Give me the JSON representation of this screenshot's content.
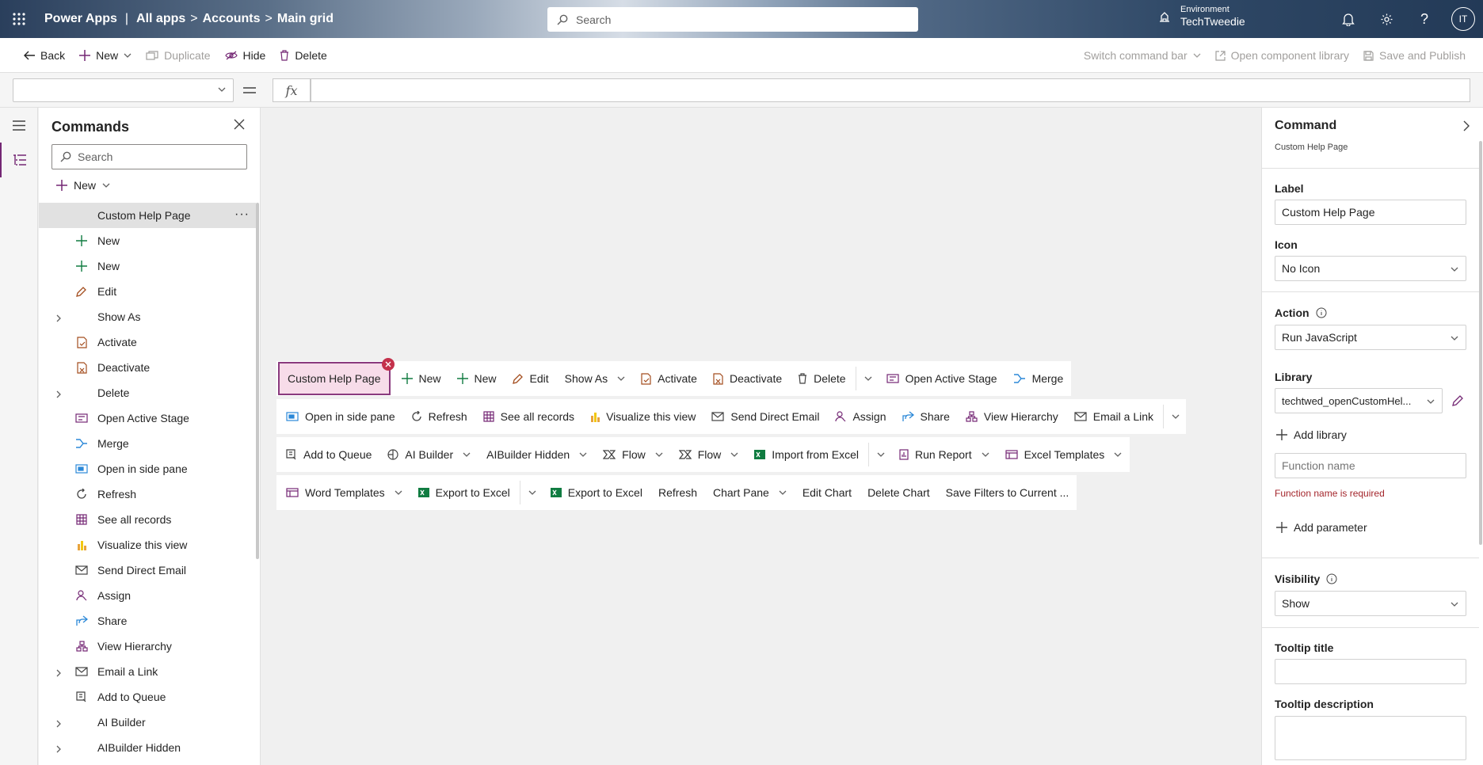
{
  "header": {
    "app_name": "Power Apps",
    "sep1": "|",
    "crumb_app": "All apps",
    "sep2": ">",
    "crumb_table": "Accounts",
    "sep3": ">",
    "crumb_view": "Main grid",
    "search_placeholder": "Search",
    "env_caption": "Environment",
    "env_name": "TechTweedie",
    "avatar_initials": "IT"
  },
  "command_bar": {
    "back": "Back",
    "new": "New",
    "duplicate": "Duplicate",
    "hide": "Hide",
    "delete": "Delete",
    "switch": "Switch command bar",
    "open_lib": "Open component library",
    "save_publish": "Save and Publish"
  },
  "formula": {
    "fx": "fx"
  },
  "left_panel": {
    "title": "Commands",
    "search_placeholder": "Search",
    "new_label": "New",
    "items": [
      {
        "label": "Custom Help Page",
        "icon": "none",
        "expand": false,
        "selected": true
      },
      {
        "label": "New",
        "icon": "plus-icon",
        "expand": false
      },
      {
        "label": "New",
        "icon": "plus-icon",
        "expand": false
      },
      {
        "label": "Edit",
        "icon": "pencil-icon",
        "expand": false
      },
      {
        "label": "Show As",
        "icon": "none",
        "expand": true
      },
      {
        "label": "Activate",
        "icon": "activate-icon",
        "expand": false
      },
      {
        "label": "Deactivate",
        "icon": "deactivate-icon",
        "expand": false
      },
      {
        "label": "Delete",
        "icon": "none",
        "expand": true
      },
      {
        "label": "Open Active Stage",
        "icon": "stage-icon",
        "expand": false
      },
      {
        "label": "Merge",
        "icon": "merge-icon",
        "expand": false
      },
      {
        "label": "Open in side pane",
        "icon": "sidepane-icon",
        "expand": false
      },
      {
        "label": "Refresh",
        "icon": "refresh-icon",
        "expand": false
      },
      {
        "label": "See all records",
        "icon": "grid-icon",
        "expand": false
      },
      {
        "label": "Visualize this view",
        "icon": "chart-icon",
        "expand": false
      },
      {
        "label": "Send Direct Email",
        "icon": "email-icon",
        "expand": false
      },
      {
        "label": "Assign",
        "icon": "person-icon",
        "expand": false
      },
      {
        "label": "Share",
        "icon": "share-icon",
        "expand": false
      },
      {
        "label": "View Hierarchy",
        "icon": "hierarchy-icon",
        "expand": false
      },
      {
        "label": "Email a Link",
        "icon": "email-icon",
        "expand": true
      },
      {
        "label": "Add to Queue",
        "icon": "queue-icon",
        "expand": false
      },
      {
        "label": "AI Builder",
        "icon": "none",
        "expand": true
      },
      {
        "label": "AIBuilder Hidden",
        "icon": "none",
        "expand": true
      }
    ]
  },
  "preview": {
    "selected": "Custom Help Page",
    "row1": [
      {
        "label": "New",
        "icon": "plus-icon"
      },
      {
        "label": "New",
        "icon": "plus-icon"
      },
      {
        "label": "Edit",
        "icon": "pencil-icon"
      },
      {
        "label": "Show As",
        "icon": "none",
        "dropdown": true
      },
      {
        "label": "Activate",
        "icon": "activate-icon"
      },
      {
        "label": "Deactivate",
        "icon": "deactivate-icon"
      },
      {
        "label": "Delete",
        "icon": "trash-icon",
        "split": true
      },
      {
        "label": "Open Active Stage",
        "icon": "stage-icon"
      },
      {
        "label": "Merge",
        "icon": "merge-icon"
      }
    ],
    "row2": [
      {
        "label": "Open in side pane",
        "icon": "sidepane-icon"
      },
      {
        "label": "Refresh",
        "icon": "refresh-icon"
      },
      {
        "label": "See all records",
        "icon": "grid-icon"
      },
      {
        "label": "Visualize this view",
        "icon": "chart-icon"
      },
      {
        "label": "Send Direct Email",
        "icon": "email-icon"
      },
      {
        "label": "Assign",
        "icon": "person-icon"
      },
      {
        "label": "Share",
        "icon": "share-icon"
      },
      {
        "label": "View Hierarchy",
        "icon": "hierarchy-icon"
      },
      {
        "label": "Email a Link",
        "icon": "email-icon",
        "split": true
      }
    ],
    "row3": [
      {
        "label": "Add to Queue",
        "icon": "queue-icon"
      },
      {
        "label": "AI Builder",
        "icon": "ai-icon",
        "dropdown": true
      },
      {
        "label": "AIBuilder Hidden",
        "icon": "none",
        "dropdown": true
      },
      {
        "label": "Flow",
        "icon": "flow-icon",
        "dropdown": true
      },
      {
        "label": "Flow",
        "icon": "flow-icon",
        "dropdown": true
      },
      {
        "label": "Import from Excel",
        "icon": "excel-icon",
        "split": true
      },
      {
        "label": "Run Report",
        "icon": "report-icon",
        "dropdown": true
      },
      {
        "label": "Excel Templates",
        "icon": "template-icon",
        "dropdown": true
      }
    ],
    "row4": [
      {
        "label": "Word Templates",
        "icon": "template-icon",
        "dropdown": true
      },
      {
        "label": "Export to Excel",
        "icon": "excel-icon",
        "split": true
      },
      {
        "label": "Export to Excel",
        "icon": "excel-icon"
      },
      {
        "label": "Refresh",
        "icon": "none"
      },
      {
        "label": "Chart Pane",
        "icon": "none",
        "dropdown": true
      },
      {
        "label": "Edit Chart",
        "icon": "none"
      },
      {
        "label": "Delete Chart",
        "icon": "none"
      },
      {
        "label": "Save Filters to Current ...",
        "icon": "none"
      }
    ]
  },
  "right_panel": {
    "title": "Command",
    "subtitle": "Custom Help Page",
    "label_caption": "Label",
    "label_value": "Custom Help Page",
    "icon_caption": "Icon",
    "icon_value": "No Icon",
    "action_caption": "Action",
    "action_value": "Run JavaScript",
    "library_caption": "Library",
    "library_value": "techtwed_openCustomHel...",
    "add_library": "Add library",
    "function_placeholder": "Function name",
    "function_error": "Function name is required",
    "add_parameter": "Add parameter",
    "visibility_caption": "Visibility",
    "visibility_value": "Show",
    "tooltip_title_caption": "Tooltip title",
    "tooltip_desc_caption": "Tooltip description"
  },
  "colors": {
    "accent": "#742774",
    "selected_outline": "#8a3a7e",
    "selected_fill": "#f7dce9",
    "error": "#a4262c",
    "excel_green": "#107c41"
  }
}
